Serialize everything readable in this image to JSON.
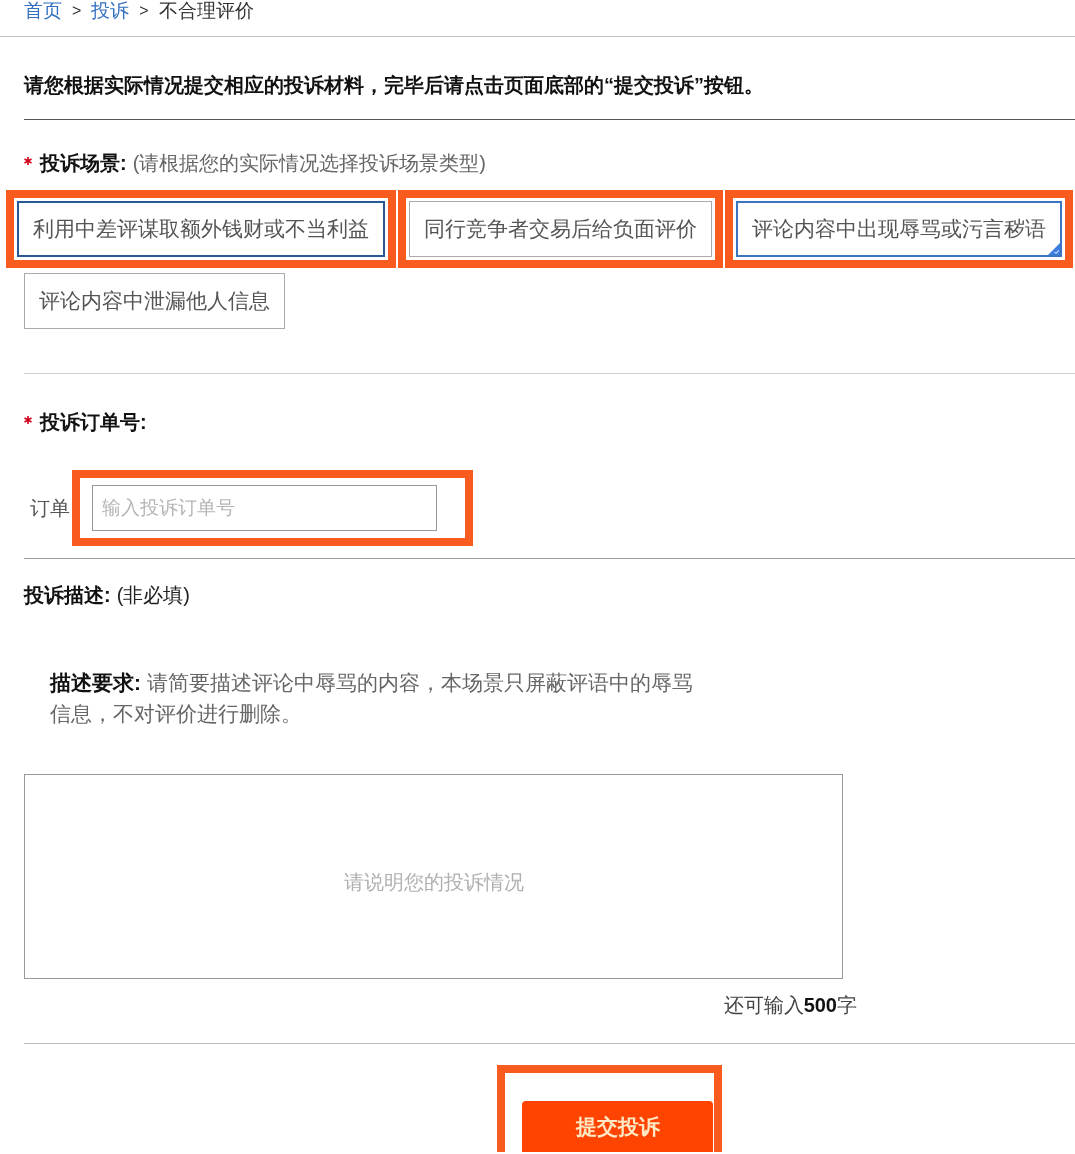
{
  "breadcrumb": {
    "separator": ">",
    "items": [
      {
        "label": "首页",
        "link": true
      },
      {
        "label": "投诉",
        "link": true
      },
      {
        "label": "不合理评价",
        "link": false
      }
    ]
  },
  "intro": "请您根据实际情况提交相应的投诉材料，完毕后请点击页面底部的“提交投诉”按钮。",
  "scene": {
    "required": true,
    "label": "投诉场景:",
    "hint": "(请根据您的实际情况选择投诉场景类型)",
    "options": [
      {
        "label": "利用中差评谋取额外钱财或不当利益",
        "selected": false,
        "highlighted": true,
        "annotated": true
      },
      {
        "label": "同行竞争者交易后给负面评价",
        "selected": false,
        "highlighted": false,
        "annotated": true
      },
      {
        "label": "评论内容中出现辱骂或污言秽语",
        "selected": true,
        "highlighted": true,
        "annotated": true
      },
      {
        "label": "评论内容中泄漏他人信息",
        "selected": false,
        "highlighted": false,
        "annotated": false
      }
    ]
  },
  "order": {
    "required": true,
    "label": "投诉订单号:",
    "field_label": "订单",
    "placeholder": "输入投诉订单号",
    "annotated": true
  },
  "description": {
    "required": false,
    "label": "投诉描述:",
    "hint": "(非必填)",
    "requirement": "**描述要求:** 请简要描述评论中辱骂的内容，本场景只屏蔽评语中的辱骂信息，不对评价进行删除。",
    "placeholder": "请说明您的投诉情况",
    "counter": "还可输入**500**字"
  },
  "submit": {
    "label": "提交投诉",
    "annotated": true
  }
}
